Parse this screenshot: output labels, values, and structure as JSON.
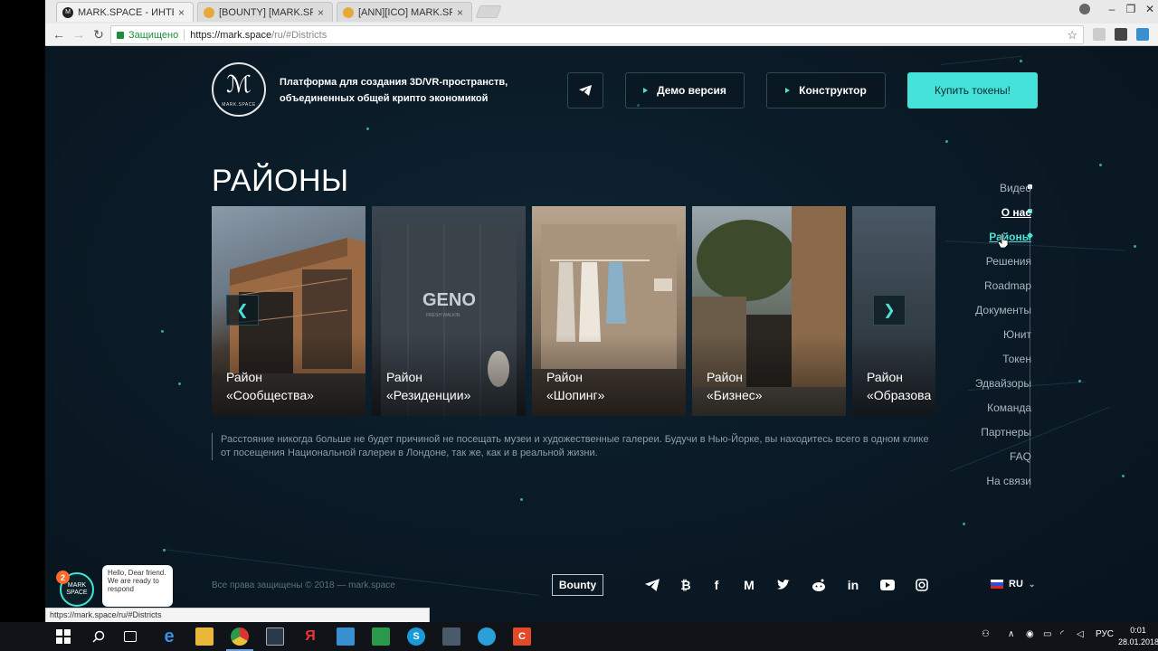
{
  "browser": {
    "tabs": [
      {
        "title": "MARK.SPACE - ИНТЕРНЕ",
        "active": true
      },
      {
        "title": "[BOUNTY] [MARK.SPACE",
        "active": false
      },
      {
        "title": "[ANN][ICO] MARK.SPACE",
        "active": false
      }
    ],
    "secure_label": "Защищено",
    "url_host": "https://mark.space",
    "url_path": "/ru/#Districts",
    "status_url": "https://mark.space/ru/#Districts"
  },
  "header": {
    "logo_small": "MARK.SPACE",
    "tagline": "Платформа для создания 3D/VR-пространств, объединенных общей крипто экономикой",
    "demo_label": "Демо версия",
    "constructor_label": "Конструктор",
    "buy_label": "Купить токены!"
  },
  "section": {
    "title": "РАЙОНЫ",
    "description": "Расстояние никогда больше не будет причиной не посещать музеи и художественные галереи. Будучи в Нью-Йорке, вы находитесь всего в одном клике от посещения Национальной галереи в Лондоне, так же, как и в реальной жизни."
  },
  "cards": [
    {
      "line1": "Район",
      "line2": "«Сообщества»"
    },
    {
      "line1": "Район",
      "line2": "«Резиденции»",
      "sign": "GENO",
      "sign_sub": "FRESH WALKIN"
    },
    {
      "line1": "Район",
      "line2": "«Шопинг»"
    },
    {
      "line1": "Район",
      "line2": "«Бизнес»"
    },
    {
      "line1": "Район",
      "line2": "«Образова"
    }
  ],
  "sidenav": [
    {
      "label": "Видео"
    },
    {
      "label": "О нас",
      "state": "bold"
    },
    {
      "label": "Районы",
      "state": "active"
    },
    {
      "label": "Решения"
    },
    {
      "label": "Roadmap"
    },
    {
      "label": "Документы"
    },
    {
      "label": "Юнит"
    },
    {
      "label": "Токен"
    },
    {
      "label": "Эдвайзоры"
    },
    {
      "label": "Команда"
    },
    {
      "label": "Партнеры"
    },
    {
      "label": "FAQ"
    },
    {
      "label": "На связи"
    }
  ],
  "footer": {
    "copyright": "Все права защищены © 2018 — mark.space",
    "bounty": "Bounty",
    "language": "RU"
  },
  "chat": {
    "badge": "2",
    "avatar_text": "MARK SPACE",
    "message": "Hello, Dear friend. We are ready to respond"
  },
  "taskbar": {
    "lang": "РУС",
    "time": "0:01",
    "date": "28.01.2018"
  },
  "colors": {
    "accent": "#44e2d8",
    "background": "#0a1a26"
  }
}
